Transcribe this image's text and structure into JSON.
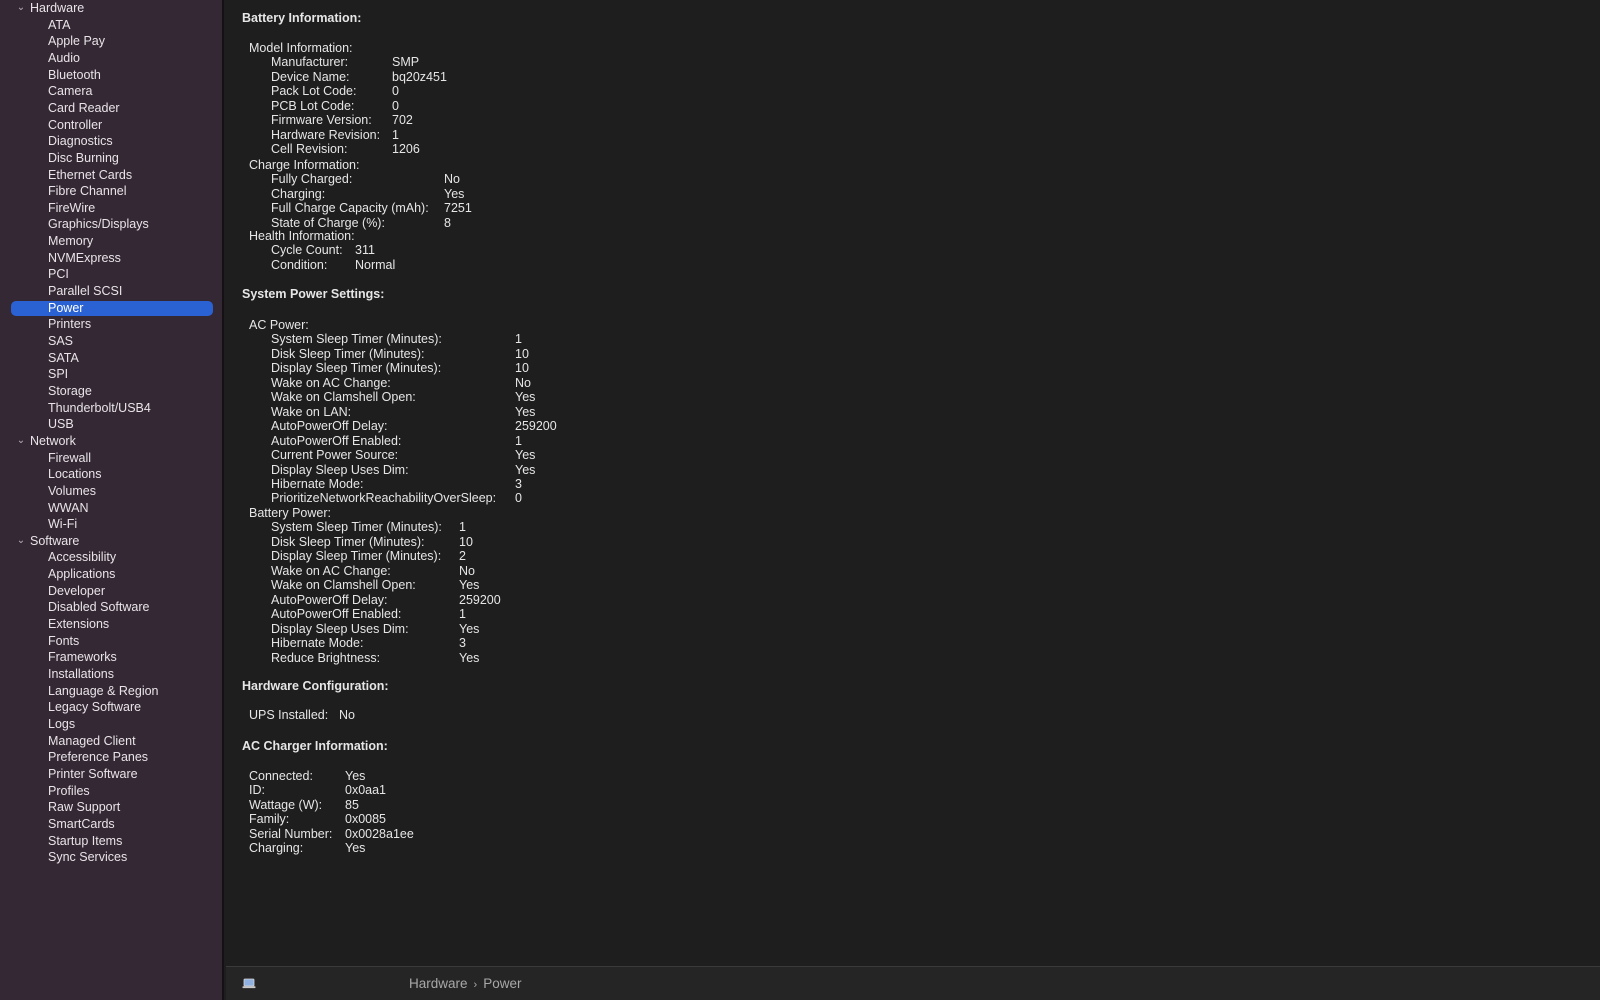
{
  "sidebar": {
    "rows": [
      {
        "label": "Hardware",
        "kind": "group"
      },
      {
        "label": "ATA",
        "kind": "child"
      },
      {
        "label": "Apple Pay",
        "kind": "child"
      },
      {
        "label": "Audio",
        "kind": "child"
      },
      {
        "label": "Bluetooth",
        "kind": "child"
      },
      {
        "label": "Camera",
        "kind": "child"
      },
      {
        "label": "Card Reader",
        "kind": "child"
      },
      {
        "label": "Controller",
        "kind": "child"
      },
      {
        "label": "Diagnostics",
        "kind": "child"
      },
      {
        "label": "Disc Burning",
        "kind": "child"
      },
      {
        "label": "Ethernet Cards",
        "kind": "child"
      },
      {
        "label": "Fibre Channel",
        "kind": "child"
      },
      {
        "label": "FireWire",
        "kind": "child"
      },
      {
        "label": "Graphics/Displays",
        "kind": "child"
      },
      {
        "label": "Memory",
        "kind": "child"
      },
      {
        "label": "NVMExpress",
        "kind": "child"
      },
      {
        "label": "PCI",
        "kind": "child"
      },
      {
        "label": "Parallel SCSI",
        "kind": "child"
      },
      {
        "label": "Power",
        "kind": "child",
        "selected": true
      },
      {
        "label": "Printers",
        "kind": "child"
      },
      {
        "label": "SAS",
        "kind": "child"
      },
      {
        "label": "SATA",
        "kind": "child"
      },
      {
        "label": "SPI",
        "kind": "child"
      },
      {
        "label": "Storage",
        "kind": "child"
      },
      {
        "label": "Thunderbolt/USB4",
        "kind": "child"
      },
      {
        "label": "USB",
        "kind": "child"
      },
      {
        "label": "Network",
        "kind": "group"
      },
      {
        "label": "Firewall",
        "kind": "child"
      },
      {
        "label": "Locations",
        "kind": "child"
      },
      {
        "label": "Volumes",
        "kind": "child"
      },
      {
        "label": "WWAN",
        "kind": "child"
      },
      {
        "label": "Wi-Fi",
        "kind": "child"
      },
      {
        "label": "Software",
        "kind": "group"
      },
      {
        "label": "Accessibility",
        "kind": "child"
      },
      {
        "label": "Applications",
        "kind": "child"
      },
      {
        "label": "Developer",
        "kind": "child"
      },
      {
        "label": "Disabled Software",
        "kind": "child"
      },
      {
        "label": "Extensions",
        "kind": "child"
      },
      {
        "label": "Fonts",
        "kind": "child"
      },
      {
        "label": "Frameworks",
        "kind": "child"
      },
      {
        "label": "Installations",
        "kind": "child"
      },
      {
        "label": "Language & Region",
        "kind": "child"
      },
      {
        "label": "Legacy Software",
        "kind": "child"
      },
      {
        "label": "Logs",
        "kind": "child"
      },
      {
        "label": "Managed Client",
        "kind": "child"
      },
      {
        "label": "Preference Panes",
        "kind": "child"
      },
      {
        "label": "Printer Software",
        "kind": "child"
      },
      {
        "label": "Profiles",
        "kind": "child"
      },
      {
        "label": "Raw Support",
        "kind": "child"
      },
      {
        "label": "SmartCards",
        "kind": "child"
      },
      {
        "label": "Startup Items",
        "kind": "child"
      },
      {
        "label": "Sync Services",
        "kind": "child"
      }
    ]
  },
  "content": {
    "sections": [
      {
        "title": "Battery Information:",
        "groups": [
          {
            "title": "Model Information:",
            "rows": [
              {
                "key": "Manufacturer:",
                "value": "SMP"
              },
              {
                "key": "Device Name:",
                "value": "bq20z451"
              },
              {
                "key": "Pack Lot Code:",
                "value": "0"
              },
              {
                "key": "PCB Lot Code:",
                "value": "0"
              },
              {
                "key": "Firmware Version:",
                "value": "702"
              },
              {
                "key": "Hardware Revision:",
                "value": "1"
              },
              {
                "key": "Cell Revision:",
                "value": "1206"
              }
            ]
          },
          {
            "title": "Charge Information:",
            "rows": [
              {
                "key": "Fully Charged:",
                "value": "No"
              },
              {
                "key": "Charging:",
                "value": "Yes"
              },
              {
                "key": "Full Charge Capacity (mAh):",
                "value": "7251"
              },
              {
                "key": "State of Charge (%):",
                "value": "8"
              }
            ]
          },
          {
            "title": "Health Information:",
            "rows": [
              {
                "key": "Cycle Count:",
                "value": "311"
              },
              {
                "key": "Condition:",
                "value": "Normal"
              }
            ]
          }
        ]
      },
      {
        "title": "System Power Settings:",
        "groups": [
          {
            "title": "AC Power:",
            "rows": [
              {
                "key": "System Sleep Timer (Minutes):",
                "value": "1"
              },
              {
                "key": "Disk Sleep Timer (Minutes):",
                "value": "10"
              },
              {
                "key": "Display Sleep Timer (Minutes):",
                "value": "10"
              },
              {
                "key": "Wake on AC Change:",
                "value": "No"
              },
              {
                "key": "Wake on Clamshell Open:",
                "value": "Yes"
              },
              {
                "key": "Wake on LAN:",
                "value": "Yes"
              },
              {
                "key": "AutoPowerOff Delay:",
                "value": "259200"
              },
              {
                "key": "AutoPowerOff Enabled:",
                "value": "1"
              },
              {
                "key": "Current Power Source:",
                "value": "Yes"
              },
              {
                "key": "Display Sleep Uses Dim:",
                "value": "Yes"
              },
              {
                "key": "Hibernate Mode:",
                "value": "3"
              },
              {
                "key": "PrioritizeNetworkReachabilityOverSleep:",
                "value": "0"
              }
            ]
          },
          {
            "title": "Battery Power:",
            "rows": [
              {
                "key": "System Sleep Timer (Minutes):",
                "value": "1"
              },
              {
                "key": "Disk Sleep Timer (Minutes):",
                "value": "10"
              },
              {
                "key": "Display Sleep Timer (Minutes):",
                "value": "2"
              },
              {
                "key": "Wake on AC Change:",
                "value": "No"
              },
              {
                "key": "Wake on Clamshell Open:",
                "value": "Yes"
              },
              {
                "key": "AutoPowerOff Delay:",
                "value": "259200"
              },
              {
                "key": "AutoPowerOff Enabled:",
                "value": "1"
              },
              {
                "key": "Display Sleep Uses Dim:",
                "value": "Yes"
              },
              {
                "key": "Hibernate Mode:",
                "value": "3"
              },
              {
                "key": "Reduce Brightness:",
                "value": "Yes"
              }
            ]
          }
        ]
      },
      {
        "title": "Hardware Configuration:",
        "rows": [
          {
            "key": "UPS Installed:",
            "value": "No"
          }
        ]
      },
      {
        "title": "AC Charger Information:",
        "rows": [
          {
            "key": "Connected:",
            "value": "Yes"
          },
          {
            "key": "ID:",
            "value": "0x0aa1"
          },
          {
            "key": "Wattage (W):",
            "value": "85"
          },
          {
            "key": "Family:",
            "value": "0x0085"
          },
          {
            "key": "Serial Number:",
            "value": "0x0028a1ee"
          },
          {
            "key": "Charging:",
            "value": "Yes"
          }
        ]
      }
    ]
  },
  "statusbar": {
    "icon": "laptop-icon",
    "breadcrumb": [
      "Hardware",
      "Power"
    ],
    "separator": "›"
  },
  "colors": {
    "sidebar_bg": "#342834",
    "content_bg": "#1e1e1e",
    "selection": "#2a62d4"
  }
}
